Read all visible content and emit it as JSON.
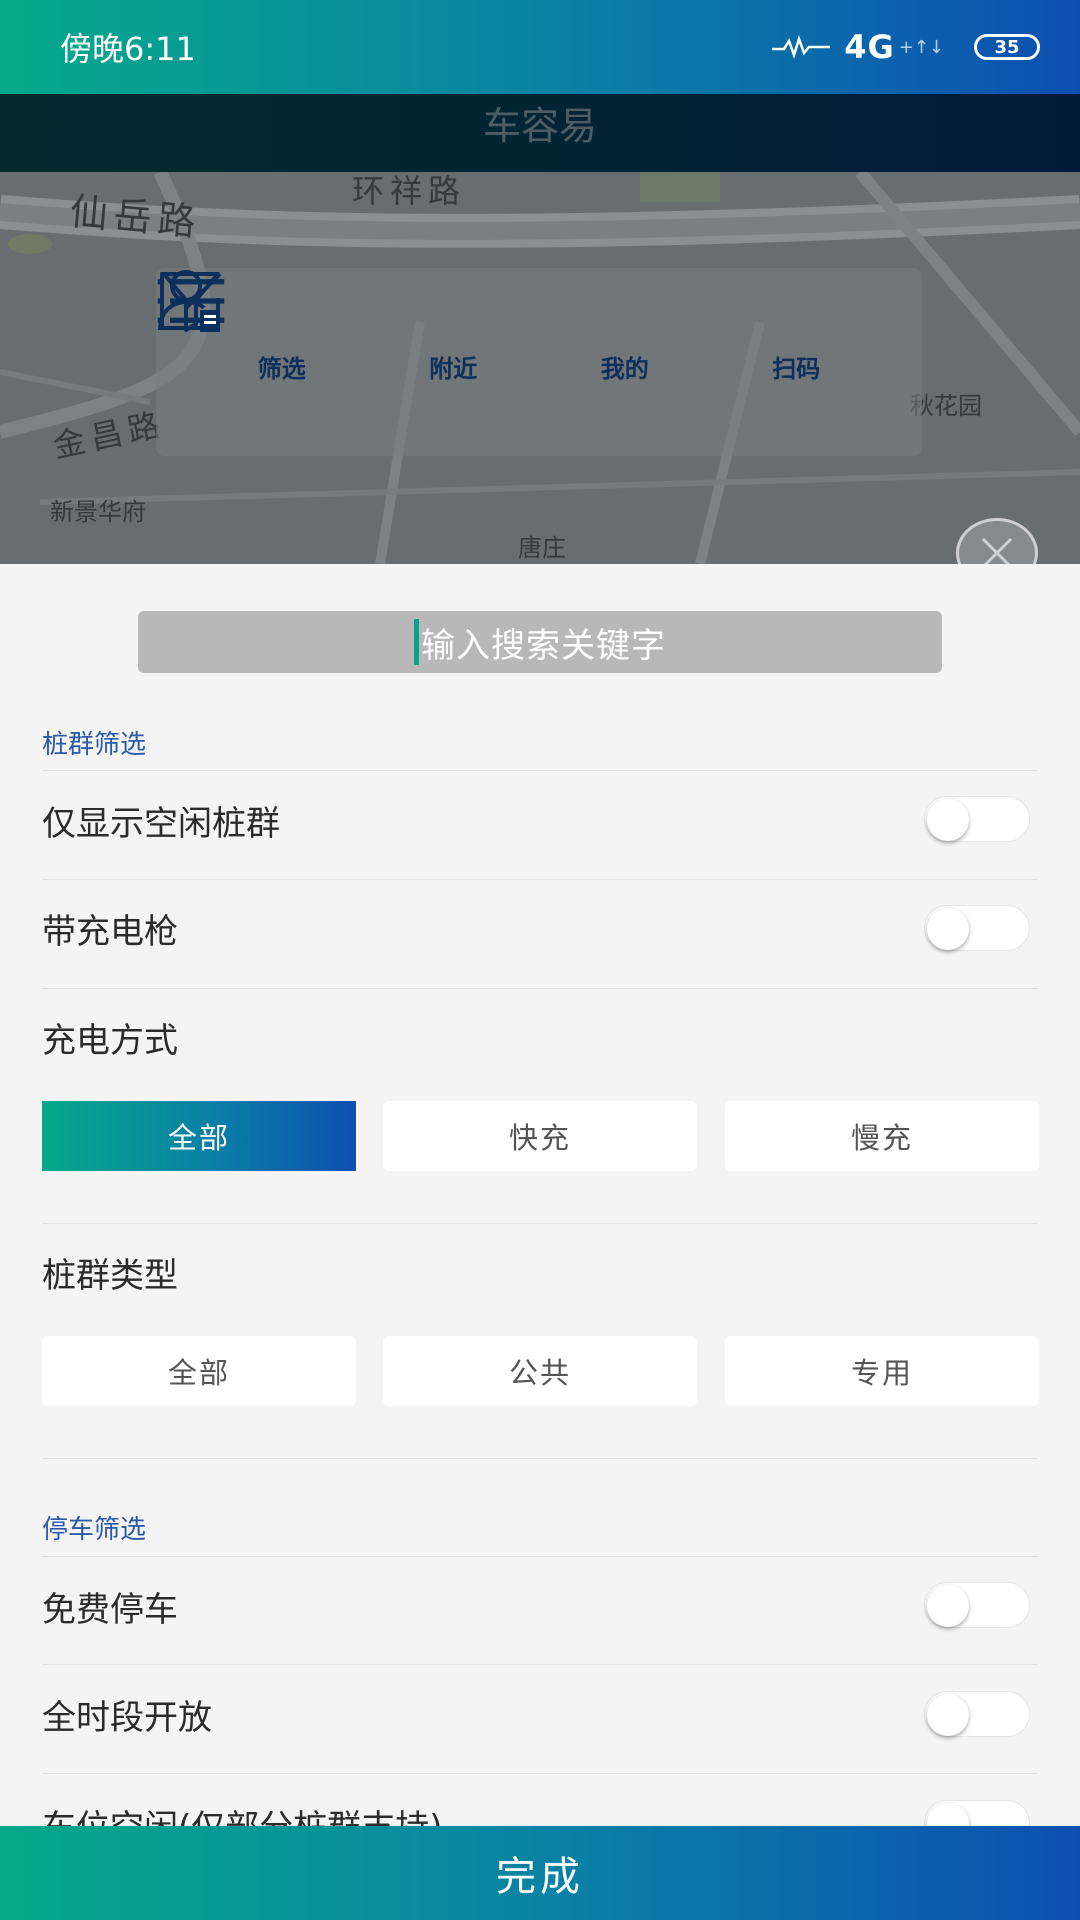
{
  "status_bar": {
    "time": "傍晚6:11",
    "network": "4G",
    "network_arrows": "+↑↓",
    "battery": "35"
  },
  "app": {
    "title": "车容易"
  },
  "map": {
    "labels": {
      "xianyue": "仙岳路",
      "huanxiang": "环祥路",
      "jinchang": "金昌路",
      "xinjing": "新景华府",
      "tangzhuang": "唐庄",
      "huayuan": "秋花园"
    }
  },
  "toolbar": {
    "filter": "筛选",
    "nearby": "附近",
    "mine": "我的",
    "scan": "扫码"
  },
  "search": {
    "placeholder": "输入搜索关键字"
  },
  "pile_filter": {
    "section_title": "桩群筛选",
    "only_idle": "仅显示空闲桩群",
    "with_gun": "带充电枪",
    "charge_mode_title": "充电方式",
    "charge_modes": [
      "全部",
      "快充",
      "慢充"
    ],
    "pile_type_title": "桩群类型",
    "pile_types": [
      "全部",
      "公共",
      "专用"
    ]
  },
  "parking_filter": {
    "section_title": "停车筛选",
    "free_parking": "免费停车",
    "all_day_open": "全时段开放",
    "spot_idle": "车位空闲(仅部分桩群支持)"
  },
  "done_button": "完成",
  "colors": {
    "accent_start": "#05a98a",
    "accent_end": "#0d4fb0",
    "section_blue": "#2c5aa8"
  }
}
